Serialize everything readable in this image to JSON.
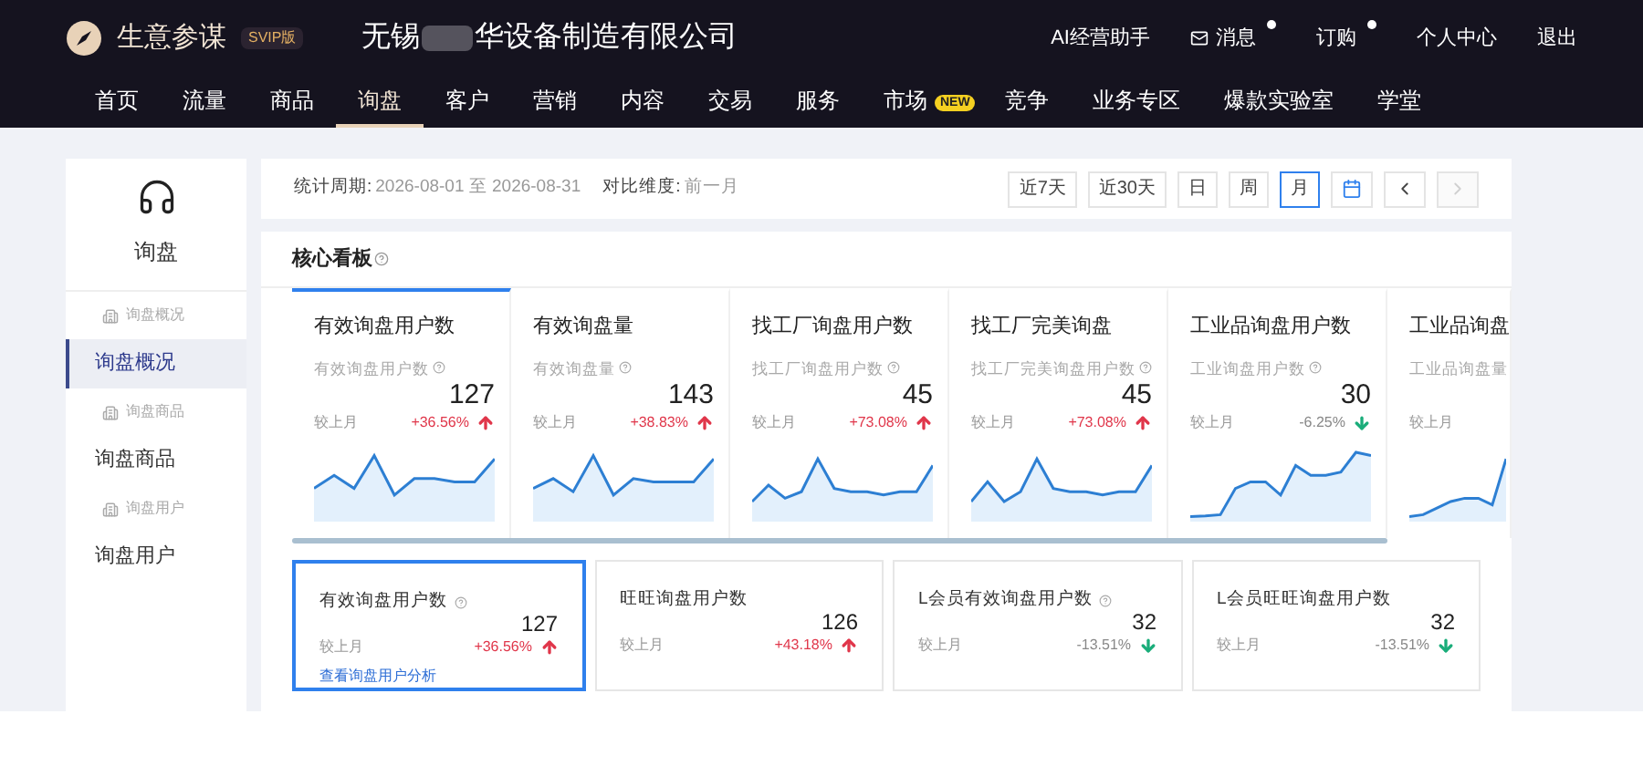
{
  "header": {
    "brand": "生意参谋",
    "edition": "SVIP版",
    "company_start": "无锡",
    "company_end": "华设备制造有限公司",
    "links": [
      {
        "label": "AI经营助手",
        "icon": false,
        "dot": false
      },
      {
        "label": "消息",
        "icon": true,
        "dot": true
      },
      {
        "label": "订购",
        "icon": false,
        "dot": true
      },
      {
        "label": "个人中心",
        "icon": false,
        "dot": false
      },
      {
        "label": "退出",
        "icon": false,
        "dot": false
      }
    ]
  },
  "nav": [
    {
      "label": "首页",
      "selected": false
    },
    {
      "label": "流量",
      "selected": false
    },
    {
      "label": "商品",
      "selected": false
    },
    {
      "label": "询盘",
      "selected": true
    },
    {
      "label": "客户",
      "selected": false
    },
    {
      "label": "营销",
      "selected": false
    },
    {
      "label": "内容",
      "selected": false
    },
    {
      "label": "交易",
      "selected": false
    },
    {
      "label": "服务",
      "selected": false
    },
    {
      "label": "市场",
      "selected": false,
      "badge": "NEW"
    },
    {
      "label": "竞争",
      "selected": false
    },
    {
      "label": "业务专区",
      "selected": false
    },
    {
      "label": "爆款实验室",
      "selected": false
    },
    {
      "label": "学堂",
      "selected": false
    }
  ],
  "sidebar": {
    "title": "询盘",
    "items": [
      {
        "label": "询盘概况",
        "kind": "group",
        "selected": false
      },
      {
        "label": "询盘概况",
        "kind": "item",
        "selected": true
      },
      {
        "label": "询盘商品",
        "kind": "group",
        "selected": false
      },
      {
        "label": "询盘商品",
        "kind": "item",
        "selected": false
      },
      {
        "label": "询盘用户",
        "kind": "group",
        "selected": false
      },
      {
        "label": "询盘用户",
        "kind": "item",
        "selected": false
      }
    ]
  },
  "period": {
    "label": "统计周期:",
    "value": "2026-08-01 至 2026-08-31",
    "compare_label": "对比维度:",
    "compare_value": "前一月"
  },
  "range_buttons": [
    {
      "kind": "text",
      "label": "近7天",
      "selected": false,
      "disabled": false
    },
    {
      "kind": "text",
      "label": "近30天",
      "selected": false,
      "disabled": false
    },
    {
      "kind": "text",
      "label": "日",
      "selected": false,
      "disabled": false
    },
    {
      "kind": "text",
      "label": "周",
      "selected": false,
      "disabled": false
    },
    {
      "kind": "text",
      "label": "月",
      "selected": true,
      "disabled": false
    },
    {
      "kind": "calendar",
      "selected": false,
      "disabled": false
    },
    {
      "kind": "prev",
      "selected": false,
      "disabled": false
    },
    {
      "kind": "next",
      "selected": false,
      "disabled": true
    }
  ],
  "board": {
    "title": "核心看板",
    "cards": [
      {
        "title": "有效询盘用户数",
        "subtitle": "有效询盘用户数",
        "help": true,
        "value": "127",
        "compare": "较上月",
        "change": "+36.56%",
        "rising": true,
        "selected": true
      },
      {
        "title": "有效询盘量",
        "subtitle": "有效询盘量",
        "help": true,
        "value": "143",
        "compare": "较上月",
        "change": "+38.83%",
        "rising": true,
        "selected": false
      },
      {
        "title": "找工厂询盘用户数",
        "subtitle": "找工厂询盘用户数",
        "help": true,
        "value": "45",
        "compare": "较上月",
        "change": "+73.08%",
        "rising": true,
        "selected": false
      },
      {
        "title": "找工厂完美询盘",
        "subtitle": "找工厂完美询盘用户数",
        "help": true,
        "value": "45",
        "compare": "较上月",
        "change": "+73.08%",
        "rising": true,
        "selected": false
      },
      {
        "title": "工业品询盘用户数",
        "subtitle": "工业询盘用户数",
        "help": true,
        "value": "30",
        "compare": "较上月",
        "change": "-6.25%",
        "rising": false,
        "selected": false
      },
      {
        "title": "工业品询盘",
        "subtitle": "工业品询盘量",
        "compare": "较上月",
        "selected": false
      }
    ],
    "details": [
      {
        "title": "有效询盘用户数",
        "help": true,
        "value": "127",
        "compare": "较上月",
        "change": "+36.56%",
        "rising": true,
        "selected": true,
        "link": "查看询盘用户分析"
      },
      {
        "title": "旺旺询盘用户数",
        "help": false,
        "value": "126",
        "compare": "较上月",
        "change": "+43.18%",
        "rising": true,
        "selected": false
      },
      {
        "title": "L会员有效询盘用户数",
        "help": true,
        "value": "32",
        "compare": "较上月",
        "change": "-13.51%",
        "rising": false,
        "selected": false
      },
      {
        "title": "L会员旺旺询盘用户数",
        "help": false,
        "value": "32",
        "compare": "较上月",
        "change": "-13.51%",
        "rising": false,
        "selected": false
      }
    ]
  }
}
